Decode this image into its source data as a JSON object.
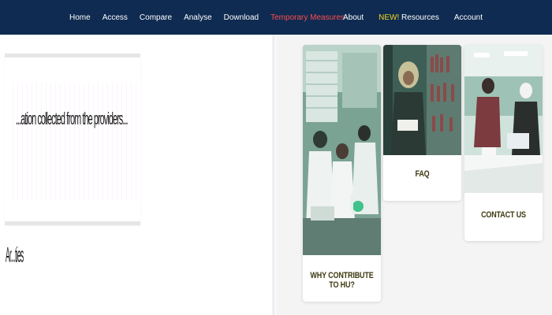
{
  "nav": {
    "left": [
      {
        "label": "Home"
      },
      {
        "label": "Access"
      },
      {
        "label": "Compare"
      },
      {
        "label": "Analyse"
      },
      {
        "label": "Download"
      },
      {
        "label": "Temporary Measures"
      }
    ],
    "right": {
      "about": "About",
      "new_badge": "NEW!",
      "resources": "Resources",
      "account": "Account"
    },
    "colors": {
      "bar": "#0f2b52",
      "link": "#ffffff",
      "temporary": "#ff4b4b",
      "new": "#f1d71a"
    }
  },
  "left_panel": {
    "box_text": "...ation collected from the providers...",
    "side_note": "Ar...ties"
  },
  "cards": [
    {
      "label": "WHY CONTRIBUTE TO HU?",
      "image": "lab-students-photo"
    },
    {
      "label": "FAQ",
      "image": "library-reader-photo"
    },
    {
      "label": "CONTACT US",
      "image": "students-laptop-photo"
    }
  ]
}
